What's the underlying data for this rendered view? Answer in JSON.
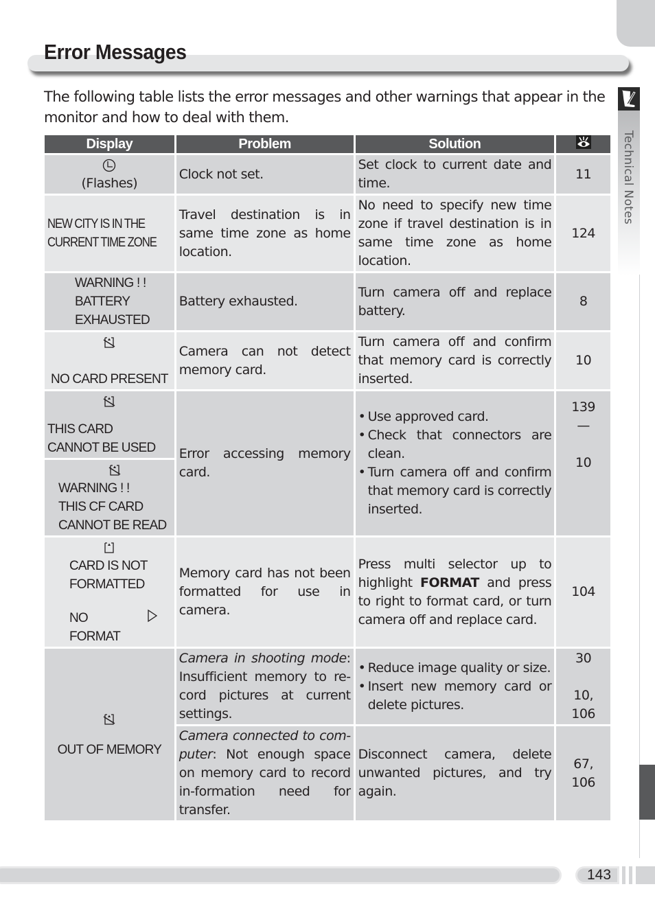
{
  "page": {
    "title": "Error Messages",
    "intro": "The following table lists the error messages and other warnings that appear in the monitor and how to deal with them.",
    "section_label": "Technical Notes",
    "page_number": "143"
  },
  "table": {
    "headers": [
      "Display",
      "Problem",
      "Solution"
    ],
    "reference_header_icon": "eye-icon",
    "rows": [
      {
        "display_icon": "clock-icon",
        "display": [
          "(Flashes)"
        ],
        "problem": "Clock not set.",
        "solution": "Set clock to current date and time.",
        "ref": "11"
      },
      {
        "display": [
          "NEW CITY IS IN THE",
          "CURRENT TIME ZONE"
        ],
        "problem": "Travel destination is in same time zone as home location.",
        "solution": "No need to specify new time zone if travel destination is in same time zone as home location.",
        "ref": "124"
      },
      {
        "display": [
          "WARNING ! !",
          "BATTERY",
          "EXHAUSTED"
        ],
        "problem": "Battery exhausted.",
        "solution": "Turn camera off and replace battery.",
        "ref": "8"
      },
      {
        "display_icon": "no-card-icon",
        "display": [
          "NO CARD PRESENT"
        ],
        "problem": "Camera can not detect memory card.",
        "solution": "Turn camera off and confirm that memory card is correctly inserted.",
        "ref": "10"
      },
      {
        "display_a_icon": "no-card-icon",
        "display_a": [
          "THIS CARD",
          "CANNOT BE USED"
        ],
        "display_b_icon": "no-card-icon",
        "display_b": [
          "WARNING ! !",
          "THIS CF CARD",
          "CANNOT BE READ"
        ],
        "problem": "Error accessing memory card.",
        "solution_bullets": [
          "Use approved card.",
          "Check that connectors are clean.",
          "Turn camera off and confirm that memory card is correctly inserted."
        ],
        "refs": [
          "139",
          "—",
          "10"
        ]
      },
      {
        "display_icon": "card-icon",
        "display": [
          "CARD IS NOT",
          "FORMATTED"
        ],
        "display_option": "NO",
        "display_option2": "FORMAT",
        "display_option_icon": "triangle-right-icon",
        "problem": "Memory card has not been formatted for use in camera.",
        "solution_pre": "Press multi selector up to highlight ",
        "solution_bold": "FORMAT",
        "solution_post": " and press to right to format card, or turn camera off and replace card.",
        "ref": "104"
      },
      {
        "display_icon": "no-card-icon",
        "display": [
          "OUT OF MEMORY"
        ],
        "sub": [
          {
            "problem_italic": "Camera in shooting mode",
            "problem": ": Insufficient memory to re-cord pictures at current settings.",
            "solution_bullets": [
              "Reduce image quality or size.",
              "Insert new memory card or delete pictures."
            ],
            "refs": [
              "30",
              "10,",
              "106"
            ]
          },
          {
            "problem_italic": "Camera connected to com-puter",
            "problem": ": Not enough space on memory card to record in-formation need for transfer.",
            "solution": "Disconnect camera, delete unwanted pictures, and try again.",
            "refs": [
              "67,",
              "106"
            ]
          }
        ]
      }
    ]
  }
}
